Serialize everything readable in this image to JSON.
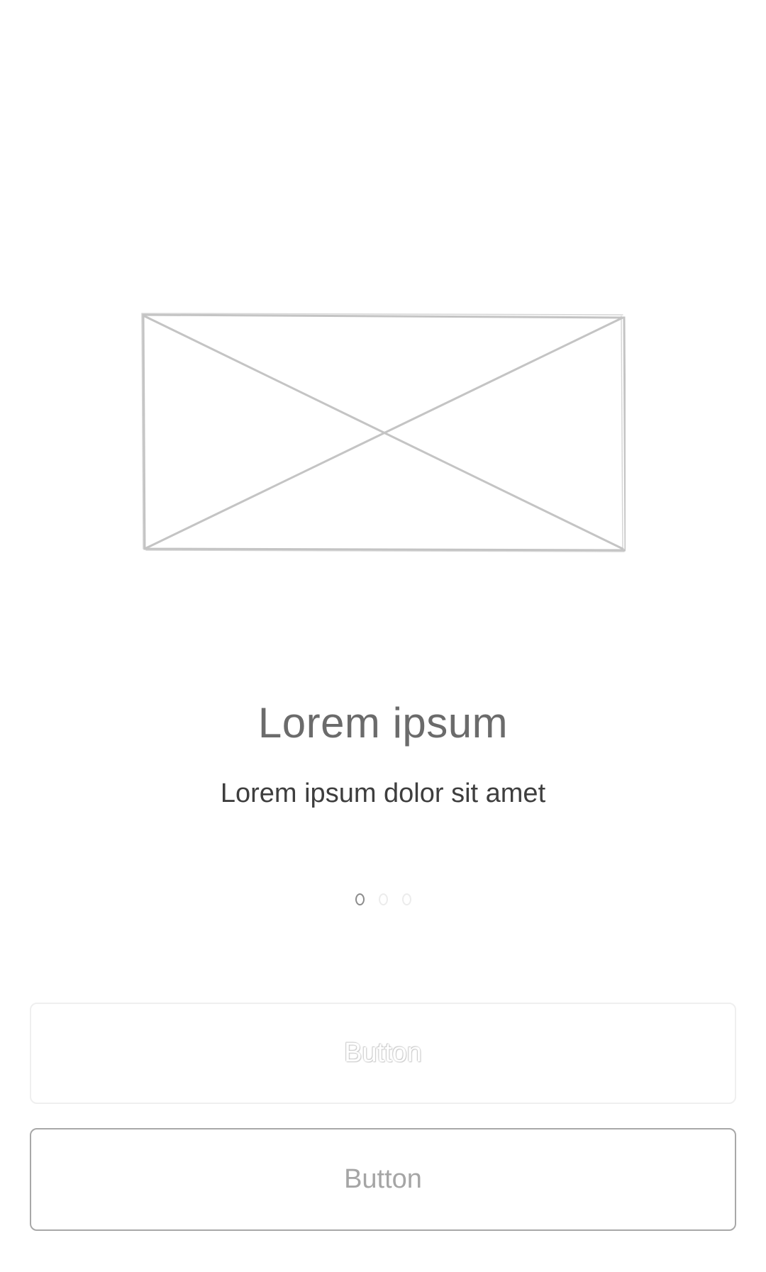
{
  "hero": {
    "icon": "image-placeholder-icon",
    "stroke_color": "#c4c4c4"
  },
  "title": "Lorem ipsum",
  "subtitle": "Lorem ipsum dolor sit amet",
  "pager": {
    "total": 3,
    "active_index": 0
  },
  "buttons": {
    "primary_label": "Button",
    "secondary_label": "Button"
  }
}
